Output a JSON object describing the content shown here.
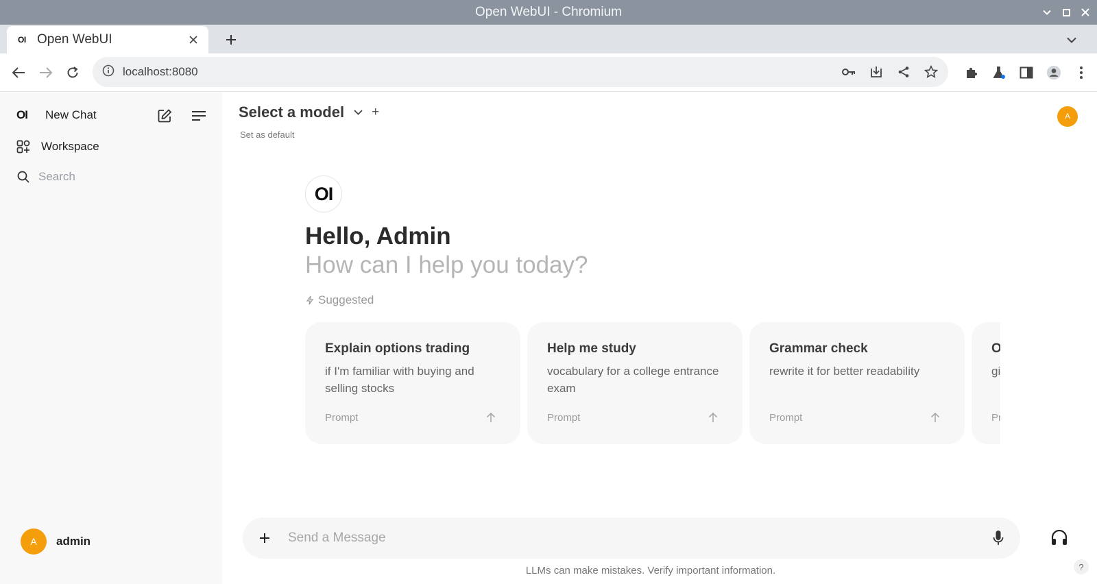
{
  "window": {
    "title": "Open WebUI - Chromium"
  },
  "tab": {
    "title": "Open WebUI",
    "favicon_text": "OI"
  },
  "address": {
    "url": "localhost:8080"
  },
  "sidebar": {
    "logo_text": "OI",
    "new_chat": "New Chat",
    "workspace": "Workspace",
    "search_placeholder": "Search",
    "user": {
      "initial": "A",
      "name": "admin"
    }
  },
  "main": {
    "model_title": "Select a model",
    "model_add": "+",
    "set_default": "Set as default",
    "avatar_initial": "A",
    "logo_text": "OI",
    "greeting": "Hello, Admin",
    "subtitle": "How can I help you today?",
    "suggested_label": "Suggested",
    "cards": [
      {
        "title": "Explain options trading",
        "subtitle": "if I'm familiar with buying and selling stocks",
        "footer": "Prompt"
      },
      {
        "title": "Help me study",
        "subtitle": "vocabulary for a college entrance exam",
        "footer": "Prompt"
      },
      {
        "title": "Grammar check",
        "subtitle": "rewrite it for better readability",
        "footer": "Prompt"
      },
      {
        "title": "O",
        "subtitle": "gi",
        "footer": "Pr"
      }
    ],
    "composer_placeholder": "Send a Message",
    "disclaimer": "LLMs can make mistakes. Verify important information.",
    "help_button": "?"
  }
}
